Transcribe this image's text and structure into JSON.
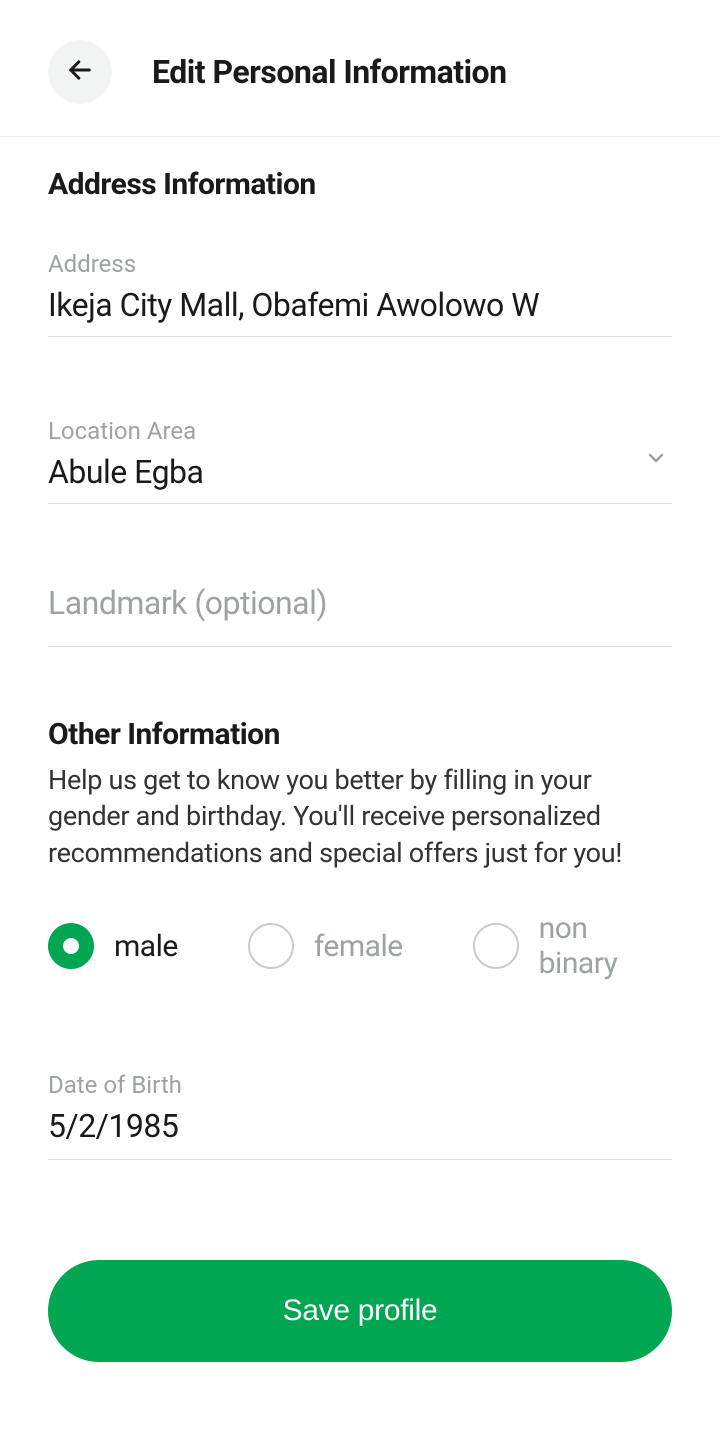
{
  "header": {
    "title": "Edit Personal Information"
  },
  "address_section": {
    "title": "Address Information",
    "address": {
      "label": "Address",
      "value": "Ikeja City Mall, Obafemi Awolowo W"
    },
    "location": {
      "label": "Location Area",
      "value": "Abule Egba"
    },
    "landmark": {
      "placeholder": "Landmark (optional)"
    }
  },
  "other_section": {
    "title": "Other Information",
    "desc": "Help us get to know you better by filling in your gender and birthday. You'll receive personalized recommendations and special offers just for you!",
    "gender": {
      "options": {
        "male": "male",
        "female": "female",
        "nonbinary": "non binary"
      },
      "selected": "male"
    },
    "dob": {
      "label": "Date of Birth",
      "value": "5/2/1985"
    }
  },
  "actions": {
    "save": "Save profile"
  }
}
